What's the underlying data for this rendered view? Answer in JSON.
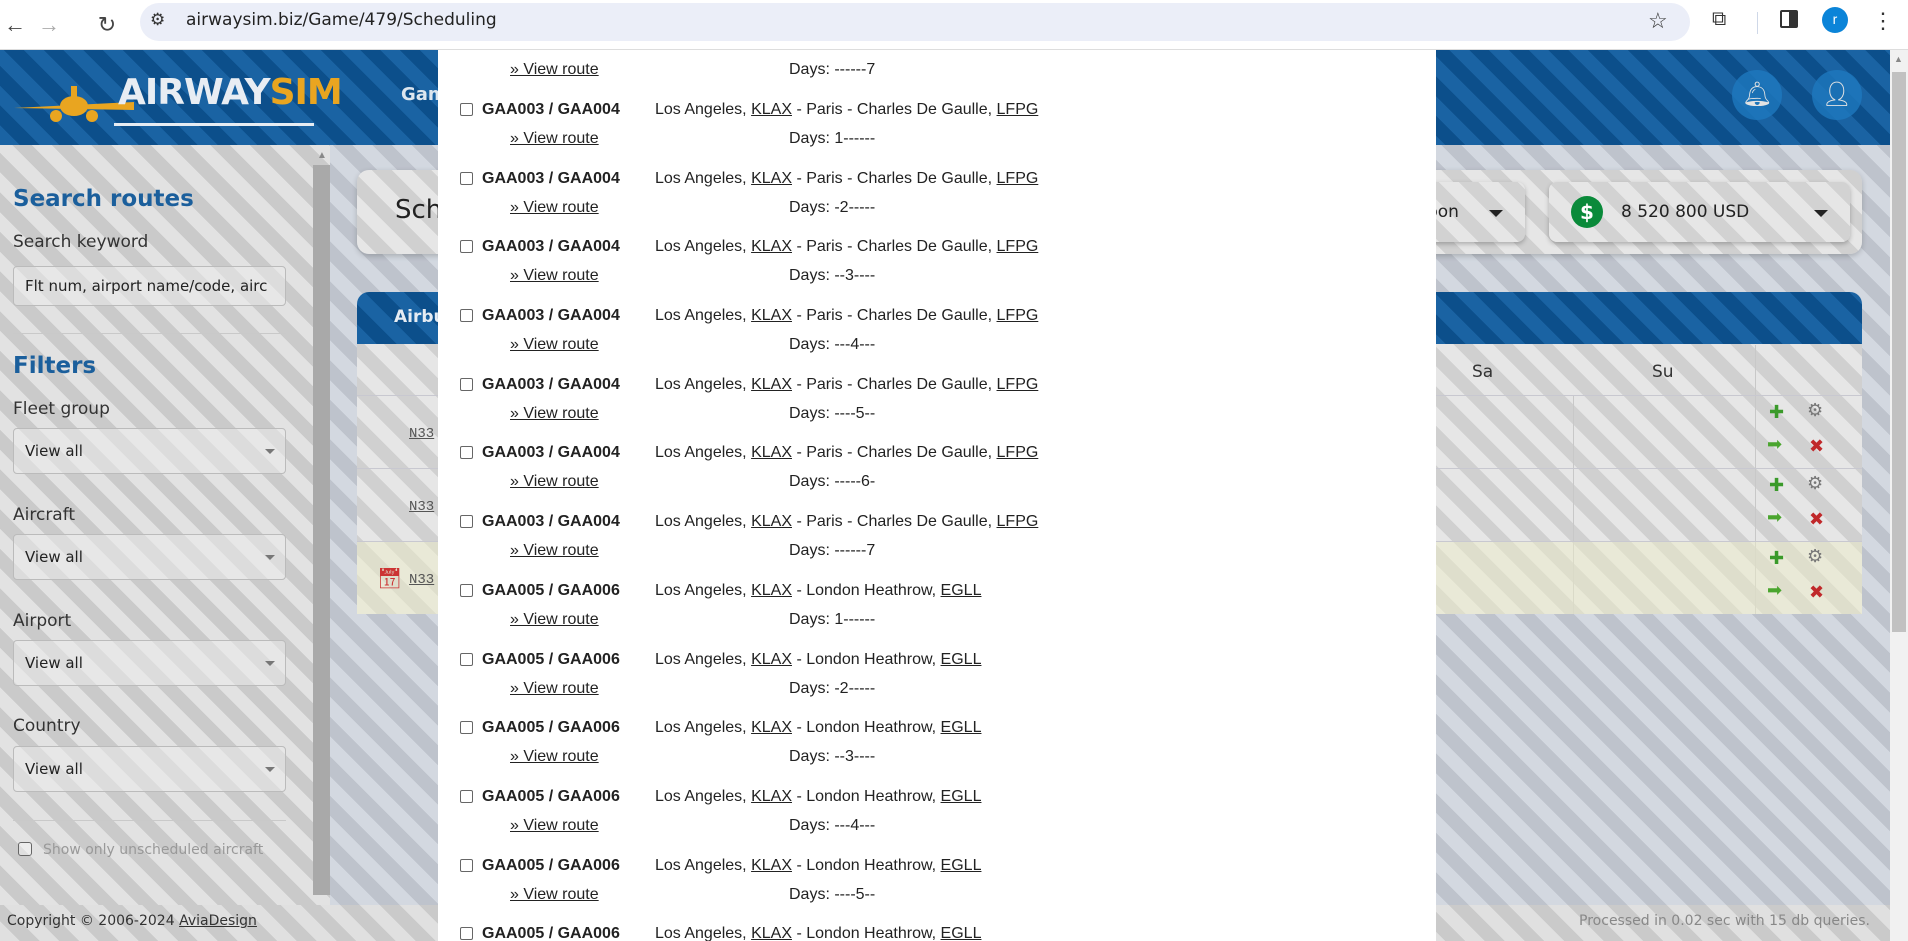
{
  "browser": {
    "url": "airwaysim.biz/Game/479/Scheduling",
    "profile_initial": "r"
  },
  "header": {
    "logo_part1": "AIRWAY",
    "logo_part2": "SIM",
    "nav_partial": "Gam"
  },
  "sidebar": {
    "search_title": "Search routes",
    "search_label": "Search keyword",
    "search_placeholder": "Flt num, airport name/code, airc",
    "filters_title": "Filters",
    "filters": [
      {
        "label": "Fleet group",
        "value": "View all"
      },
      {
        "label": "Aircraft",
        "value": "View all"
      },
      {
        "label": "Airport",
        "value": "View all"
      },
      {
        "label": "Country",
        "value": "View all"
      }
    ],
    "unscheduled_label": "Show only unscheduled aircraft"
  },
  "main": {
    "title_partial": "Sch",
    "carbon_partial": "rbon",
    "balance": "8 520 800 USD",
    "table_title_partial": "Airbu",
    "columns": [
      "Sa",
      "Su"
    ],
    "rows": [
      {
        "reg": "N33"
      },
      {
        "reg": "N33"
      },
      {
        "reg": "N33"
      }
    ]
  },
  "popup": {
    "view_route_label": "» View route",
    "days_prefix": "Days: ",
    "entries": [
      {
        "code": "",
        "origin": "",
        "origin_code": "",
        "dest": "",
        "dest_code": "",
        "days": "------7"
      },
      {
        "code": "GAA003 / GAA004",
        "origin": "Los Angeles, ",
        "origin_code": "KLAX",
        "dest": " - Paris - Charles De Gaulle, ",
        "dest_code": "LFPG",
        "days": "1------"
      },
      {
        "code": "GAA003 / GAA004",
        "origin": "Los Angeles, ",
        "origin_code": "KLAX",
        "dest": " - Paris - Charles De Gaulle, ",
        "dest_code": "LFPG",
        "days": "-2-----"
      },
      {
        "code": "GAA003 / GAA004",
        "origin": "Los Angeles, ",
        "origin_code": "KLAX",
        "dest": " - Paris - Charles De Gaulle, ",
        "dest_code": "LFPG",
        "days": "--3----"
      },
      {
        "code": "GAA003 / GAA004",
        "origin": "Los Angeles, ",
        "origin_code": "KLAX",
        "dest": " - Paris - Charles De Gaulle, ",
        "dest_code": "LFPG",
        "days": "---4---"
      },
      {
        "code": "GAA003 / GAA004",
        "origin": "Los Angeles, ",
        "origin_code": "KLAX",
        "dest": " - Paris - Charles De Gaulle, ",
        "dest_code": "LFPG",
        "days": "----5--"
      },
      {
        "code": "GAA003 / GAA004",
        "origin": "Los Angeles, ",
        "origin_code": "KLAX",
        "dest": " - Paris - Charles De Gaulle, ",
        "dest_code": "LFPG",
        "days": "-----6-"
      },
      {
        "code": "GAA003 / GAA004",
        "origin": "Los Angeles, ",
        "origin_code": "KLAX",
        "dest": " - Paris - Charles De Gaulle, ",
        "dest_code": "LFPG",
        "days": "------7"
      },
      {
        "code": "GAA005 / GAA006",
        "origin": "Los Angeles, ",
        "origin_code": "KLAX",
        "dest": " - London Heathrow, ",
        "dest_code": "EGLL",
        "days": "1------"
      },
      {
        "code": "GAA005 / GAA006",
        "origin": "Los Angeles, ",
        "origin_code": "KLAX",
        "dest": " - London Heathrow, ",
        "dest_code": "EGLL",
        "days": "-2-----"
      },
      {
        "code": "GAA005 / GAA006",
        "origin": "Los Angeles, ",
        "origin_code": "KLAX",
        "dest": " - London Heathrow, ",
        "dest_code": "EGLL",
        "days": "--3----"
      },
      {
        "code": "GAA005 / GAA006",
        "origin": "Los Angeles, ",
        "origin_code": "KLAX",
        "dest": " - London Heathrow, ",
        "dest_code": "EGLL",
        "days": "---4---"
      },
      {
        "code": "GAA005 / GAA006",
        "origin": "Los Angeles, ",
        "origin_code": "KLAX",
        "dest": " - London Heathrow, ",
        "dest_code": "EGLL",
        "days": "----5--"
      },
      {
        "code": "GAA005 / GAA006",
        "origin": "Los Angeles, ",
        "origin_code": "KLAX",
        "dest": " - London Heathrow, ",
        "dest_code": "EGLL",
        "days": ""
      }
    ]
  },
  "footer": {
    "copyright": "Copyright © 2006-2024 ",
    "company": "AviaDesign",
    "processed": "Processed in 0.02 sec with 15 db queries."
  },
  "colors": {
    "brand_blue": "#1a63a3",
    "logo_gold": "#e9a520",
    "money_green": "#0a8a3a"
  }
}
